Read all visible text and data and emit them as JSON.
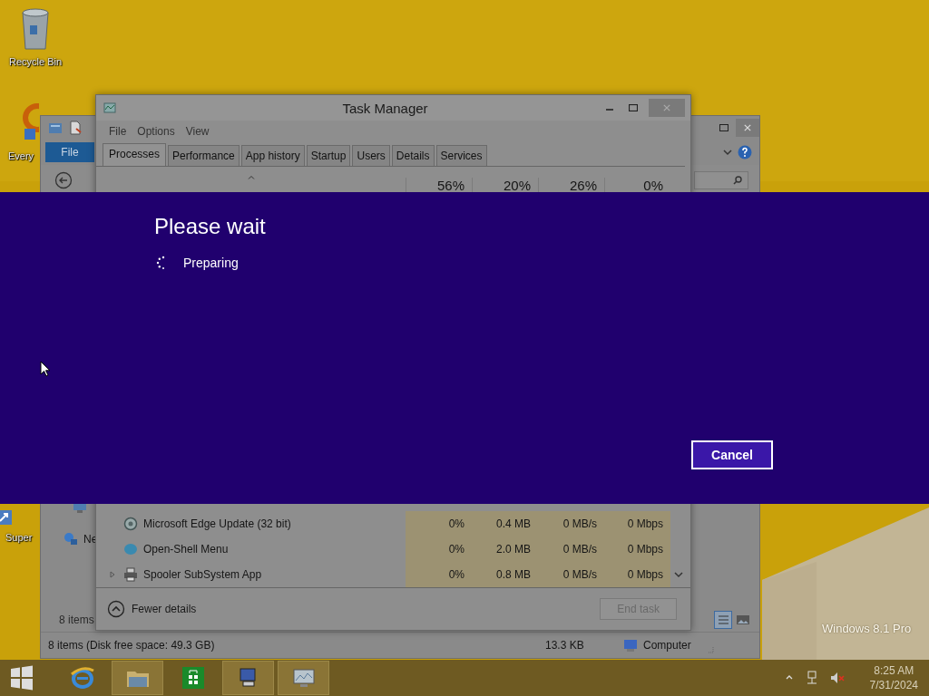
{
  "desktop_icons": [
    {
      "kind": "recycle",
      "label": "Recycle Bin"
    },
    {
      "kind": "search",
      "label": "Every"
    },
    {
      "kind": "shortcut",
      "label": "Super"
    }
  ],
  "explorer": {
    "ribbon_tab": "File",
    "nav_item": "Ne",
    "item_count": "8 items",
    "status": {
      "summary": "8 items (Disk free space: 49.3 GB)",
      "size": "13.3 KB",
      "location": "Computer"
    }
  },
  "task_manager": {
    "title": "Task Manager",
    "menu": [
      "File",
      "Options",
      "View"
    ],
    "tabs": [
      {
        "label": "Processes",
        "selected": true
      },
      {
        "label": "Performance",
        "selected": false
      },
      {
        "label": "App history",
        "selected": false
      },
      {
        "label": "Startup",
        "selected": false
      },
      {
        "label": "Users",
        "selected": false
      },
      {
        "label": "Details",
        "selected": false
      },
      {
        "label": "Services",
        "selected": false
      }
    ],
    "column_totals": [
      "56%",
      "20%",
      "26%",
      "0%"
    ],
    "rows": [
      {
        "kind": "service",
        "name": "Microsoft Edge Update (32 bit)",
        "expandable": false,
        "cpu": "0%",
        "memory": "0.4 MB",
        "disk": "0 MB/s",
        "network": "0 Mbps"
      },
      {
        "kind": "app",
        "name": "Open-Shell Menu",
        "expandable": false,
        "cpu": "0%",
        "memory": "2.0 MB",
        "disk": "0 MB/s",
        "network": "0 Mbps"
      },
      {
        "kind": "printer",
        "name": "Spooler SubSystem App",
        "expandable": true,
        "cpu": "0%",
        "memory": "0.8 MB",
        "disk": "0 MB/s",
        "network": "0 Mbps"
      }
    ],
    "footer_toggle": "Fewer details",
    "end_task": {
      "label": "End task",
      "disabled": true
    }
  },
  "dialog": {
    "title": "Please wait",
    "status": "Preparing",
    "button": "Cancel"
  },
  "watermark": "Windows 8.1 Pro",
  "taskbar": {
    "apps": [
      {
        "kind": "browser",
        "open": false
      },
      {
        "kind": "folder",
        "open": true
      },
      {
        "kind": "store",
        "open": false
      },
      {
        "kind": "network",
        "open": true
      },
      {
        "kind": "monitor",
        "open": true
      }
    ],
    "clock": {
      "time": "8:25 AM",
      "date": "7/31/2024"
    }
  }
}
